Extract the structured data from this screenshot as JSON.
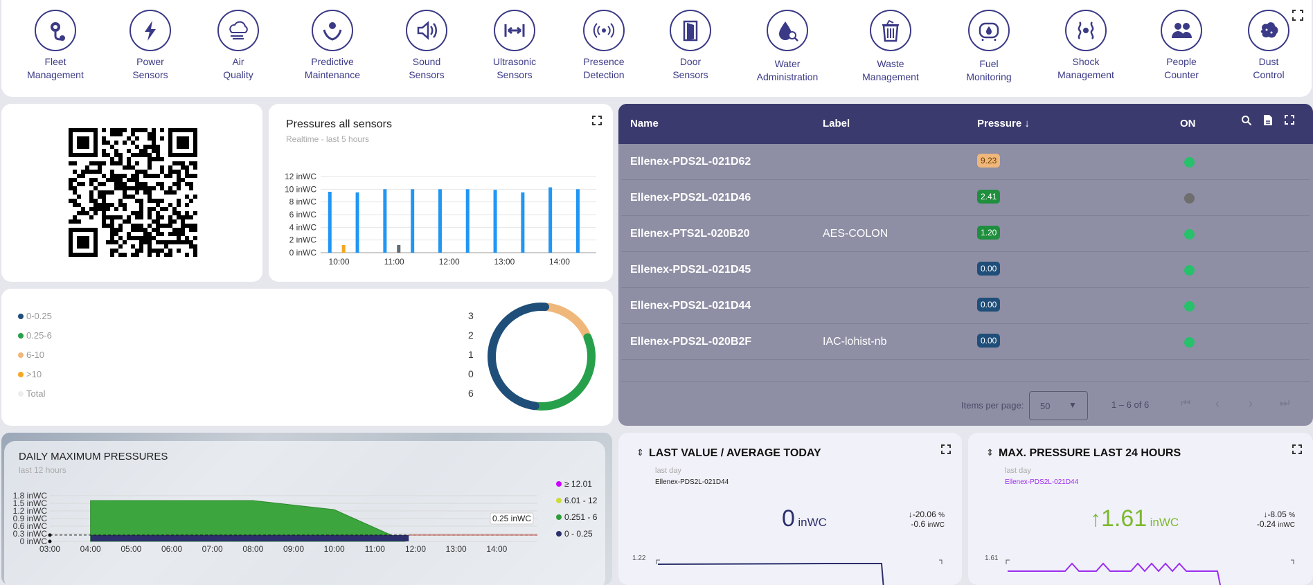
{
  "nav": [
    {
      "l1": "Fleet",
      "l2": "Management",
      "icon": "fleet-management-icon"
    },
    {
      "l1": "Power",
      "l2": "Sensors",
      "icon": "power-sensors-icon"
    },
    {
      "l1": "Air",
      "l2": "Quality",
      "icon": "air-quality-icon"
    },
    {
      "l1": "Predictive",
      "l2": "Maintenance",
      "icon": "predictive-maintenance-icon"
    },
    {
      "l1": "Sound",
      "l2": "Sensors",
      "icon": "sound-sensors-icon"
    },
    {
      "l1": "Ultrasonic",
      "l2": "Sensors",
      "icon": "ultrasonic-sensors-icon"
    },
    {
      "l1": "Presence",
      "l2": "Detection",
      "icon": "presence-detection-icon"
    },
    {
      "l1": "Door",
      "l2": "Sensors",
      "icon": "door-sensors-icon"
    },
    {
      "l1": "Water",
      "l2": "Administration",
      "icon": "water-administration-icon"
    },
    {
      "l1": "Waste",
      "l2": "Management",
      "icon": "waste-management-icon"
    },
    {
      "l1": "Fuel",
      "l2": "Monitoring",
      "icon": "fuel-monitoring-icon"
    },
    {
      "l1": "Shock",
      "l2": "Management",
      "icon": "shock-management-icon"
    },
    {
      "l1": "People",
      "l2": "Counter",
      "icon": "people-counter-icon"
    },
    {
      "l1": "Dust",
      "l2": "Control",
      "icon": "dust-control-icon"
    }
  ],
  "pressures_chart": {
    "title": "Pressures all sensors",
    "subtitle": "Realtime - last 5 hours"
  },
  "chart_data": [
    {
      "type": "bar",
      "title": "Pressures all sensors",
      "subtitle": "Realtime - last 5 hours",
      "y_ticks": [
        "0 inWC",
        "2 inWC",
        "4 inWC",
        "6 inWC",
        "8 inWC",
        "10 inWC",
        "12 inWC"
      ],
      "x_ticks": [
        "10:00",
        "11:00",
        "12:00",
        "13:00",
        "14:00"
      ],
      "ylim": [
        0,
        12
      ],
      "series": [
        {
          "color": "#2196f3",
          "points": [
            {
              "t": "09:50",
              "v": 9.6
            },
            {
              "t": "10:20",
              "v": 9.5
            },
            {
              "t": "10:50",
              "v": 10
            },
            {
              "t": "11:20",
              "v": 10
            },
            {
              "t": "11:50",
              "v": 10
            },
            {
              "t": "12:20",
              "v": 10
            },
            {
              "t": "12:50",
              "v": 9.9
            },
            {
              "t": "13:20",
              "v": 9.5
            },
            {
              "t": "13:50",
              "v": 10.3
            },
            {
              "t": "14:20",
              "v": 10
            }
          ]
        },
        {
          "color": "#f5a623",
          "points": [
            {
              "t": "10:05",
              "v": 1.2
            }
          ]
        },
        {
          "color": "#616b73",
          "points": [
            {
              "t": "11:05",
              "v": 1.2
            }
          ]
        }
      ],
      "grid": true
    },
    {
      "type": "pie",
      "slices": [
        {
          "label": "0-0.25",
          "value": 3,
          "color": "#1f4e79"
        },
        {
          "label": "0.25-6",
          "value": 2,
          "color": "#27a04b"
        },
        {
          "label": "6-10",
          "value": 1,
          "color": "#f0b77a"
        },
        {
          "label": ">10",
          "value": 0,
          "color": "#f5a623"
        }
      ],
      "total": 6
    },
    {
      "type": "area",
      "title": "DAILY MAXIMUM PRESSURES",
      "subtitle": "last 12 hours",
      "y_ticks": [
        "0 inWC",
        "0.3 inWC",
        "0.6 inWC",
        "0.9 inWC",
        "1.2 inWC",
        "1.5 inWC",
        "1.8 inWC"
      ],
      "x_ticks": [
        "03:00",
        "04:00",
        "05:00",
        "06:00",
        "07:00",
        "08:00",
        "09:00",
        "10:00",
        "11:00",
        "12:00",
        "13:00",
        "14:00"
      ],
      "ylim": [
        0,
        1.8
      ],
      "x": [
        "04:00",
        "08:00",
        "10:00",
        "11:45"
      ],
      "values": [
        1.61,
        1.61,
        1.25,
        0
      ],
      "threshold_label": "0.25 inWC",
      "legend": [
        {
          "label": "≥ 12.01",
          "color": "#cc00ff"
        },
        {
          "label": "6.01 - 12",
          "color": "#cddc39"
        },
        {
          "label": "0.251 - 6",
          "color": "#2e9c3a"
        },
        {
          "label": "0 - 0.25",
          "color": "#2b2f6b"
        }
      ]
    }
  ],
  "donut_legend": [
    {
      "label": "0-0.25",
      "count": "3",
      "color": "#1f4e79"
    },
    {
      "label": "0.25-6",
      "count": "2",
      "color": "#27a04b"
    },
    {
      "label": "6-10",
      "count": "1",
      "color": "#f0b77a"
    },
    {
      "label": ">10",
      "count": "0",
      "color": "#f5a623"
    },
    {
      "label": "Total",
      "count": "6",
      "color": "#eeeeee"
    }
  ],
  "table": {
    "headers": {
      "name": "Name",
      "label": "Label",
      "pressure": "Pressure",
      "on": "ON"
    },
    "rows": [
      {
        "name": "Ellenex-PDS2L-021D62",
        "label": "",
        "pressure": "9.23",
        "badge": "#f0b77a",
        "badge_text": "#6b3d00",
        "on": "#27c06b"
      },
      {
        "name": "Ellenex-PDS2L-021D46",
        "label": "",
        "pressure": "2.41",
        "badge": "#1f8e3d",
        "badge_text": "#ffffff",
        "on": "#6e6e6e"
      },
      {
        "name": "Ellenex-PTS2L-020B20",
        "label": "AES-COLON",
        "pressure": "1.20",
        "badge": "#1f8e3d",
        "badge_text": "#ffffff",
        "on": "#27c06b"
      },
      {
        "name": "Ellenex-PDS2L-021D45",
        "label": "",
        "pressure": "0.00",
        "badge": "#1f4e79",
        "badge_text": "#ffffff",
        "on": "#27c06b"
      },
      {
        "name": "Ellenex-PDS2L-021D44",
        "label": "",
        "pressure": "0.00",
        "badge": "#1f4e79",
        "badge_text": "#ffffff",
        "on": "#27c06b"
      },
      {
        "name": "Ellenex-PDS2L-020B2F",
        "label": "IAC-lohist-nb",
        "pressure": "0.00",
        "badge": "#1f4e79",
        "badge_text": "#ffffff",
        "on": "#27c06b"
      }
    ],
    "items_per_page_label": "Items per page:",
    "items_per_page": "50",
    "range": "1 – 6 of 6"
  },
  "daily": {
    "title": "DAILY MAXIMUM PRESSURES",
    "subtitle": "last 12 hours",
    "threshold": "0.25 inWC"
  },
  "last_value": {
    "title": "LAST VALUE / AVERAGE TODAY",
    "sub1": "last day",
    "sub2": "Ellenex-PDS2L-021D44",
    "value": "0",
    "unit": "inWC",
    "delta_pct": "-20.06",
    "delta_pct_unit": "%",
    "delta_abs": "-0.6",
    "delta_abs_unit": "inWC",
    "axis_max": "1.22"
  },
  "max_pressure": {
    "title": "MAX. PRESSURE LAST 24 HOURS",
    "sub1": "last day",
    "sub2": "Ellenex-PDS2L-021D44",
    "value": "1.61",
    "unit": "inWC",
    "delta_pct": "-8.05",
    "delta_pct_unit": "%",
    "delta_abs": "-0.24",
    "delta_abs_unit": "inWC",
    "axis_max": "1.61"
  },
  "colors": {
    "brand": "#3b3a86",
    "table_header": "#3b3a6e",
    "table_body": "#8e8ea5",
    "bar": "#2196f3",
    "green_value": "#7cb82f",
    "purple_line": "#9b2cf0"
  }
}
